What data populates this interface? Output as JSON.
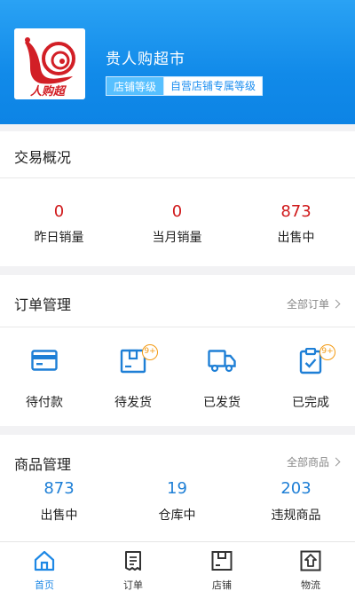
{
  "shop": {
    "name": "贵人购超市",
    "level_label": "店铺等级",
    "exclusive_level_label": "自营店铺专属等级",
    "logo_text": "人购超"
  },
  "trade": {
    "title": "交易概况",
    "stats": [
      {
        "value": "0",
        "label": "昨日销量"
      },
      {
        "value": "0",
        "label": "当月销量"
      },
      {
        "value": "873",
        "label": "出售中"
      }
    ]
  },
  "orders": {
    "title": "订单管理",
    "all_label": "全部订单",
    "items": [
      {
        "label": "待付款",
        "icon": "card-icon",
        "badge": ""
      },
      {
        "label": "待发货",
        "icon": "package-icon",
        "badge": "9+"
      },
      {
        "label": "已发货",
        "icon": "truck-icon",
        "badge": ""
      },
      {
        "label": "已完成",
        "icon": "clipboard-check-icon",
        "badge": "9+"
      }
    ]
  },
  "goods": {
    "title": "商品管理",
    "all_label": "全部商品",
    "stats": [
      {
        "value": "873",
        "label": "出售中"
      },
      {
        "value": "19",
        "label": "仓库中"
      },
      {
        "value": "203",
        "label": "违规商品"
      }
    ]
  },
  "tabbar": {
    "items": [
      {
        "label": "首页",
        "icon": "home-icon",
        "active": true
      },
      {
        "label": "订单",
        "icon": "order-doc-icon",
        "active": false
      },
      {
        "label": "店铺",
        "icon": "store-box-icon",
        "active": false
      },
      {
        "label": "物流",
        "icon": "logistics-icon",
        "active": false
      }
    ]
  },
  "colors": {
    "header_blue": "#118ae9",
    "accent_red": "#d0191b",
    "icon_blue": "#1e7fd6",
    "badge_orange": "#f39a12"
  }
}
